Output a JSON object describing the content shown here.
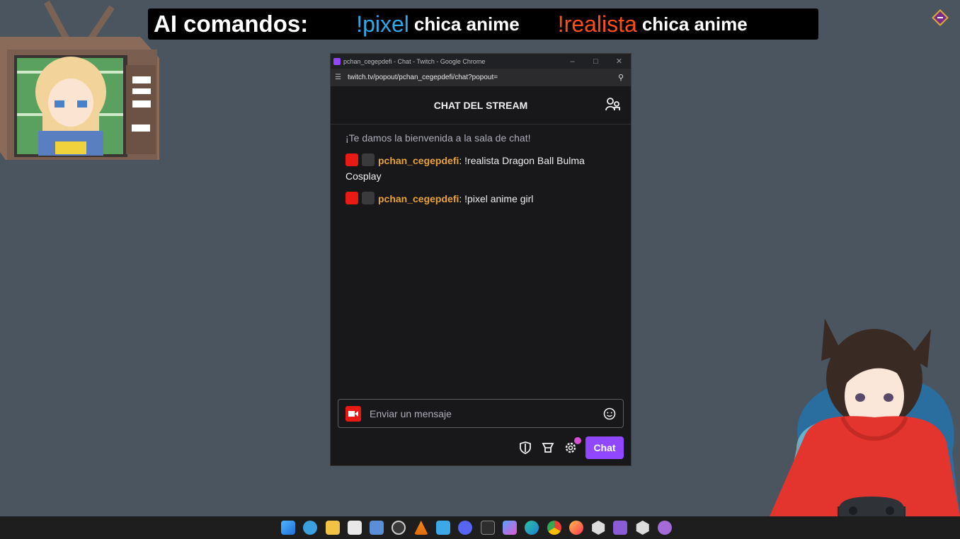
{
  "banner": {
    "lead": "AI comandos:",
    "cmd1": "!pixel",
    "rest1": "chica anime",
    "cmd2": "!realista",
    "rest2": "chica anime",
    "colors": {
      "pixel": "#2ea8e6",
      "realista": "#ff4d1a"
    }
  },
  "window": {
    "title": "pchan_cegepdefi - Chat - Twitch - Google Chrome",
    "url": "twitch.tv/popout/pchan_cegepdefi/chat?popout="
  },
  "chat": {
    "header": "CHAT DEL STREAM",
    "welcome": "¡Te damos la bienvenida a la sala de chat!",
    "messages": [
      {
        "user": "pchan_cegepdefi",
        "text": ": !realista Dragon Ball Bulma Cosplay"
      },
      {
        "user": "pchan_cegepdefi",
        "text": ": !pixel anime girl"
      }
    ],
    "input_placeholder": "Enviar un mensaje",
    "send_label": "Chat",
    "accent": "#9147ff",
    "username_color": "#e8a33d"
  },
  "taskbar": {
    "icons": [
      "windows-start-icon",
      "widgets-icon",
      "file-explorer-icon",
      "snipping-tool-icon",
      "vs-code-icon",
      "obs-icon",
      "vlc-icon",
      "notepad-icon",
      "discord-icon",
      "terminal-icon",
      "copilot-icon",
      "edge-icon",
      "chrome-icon",
      "firefox-icon",
      "unity-icon",
      "visual-studio-icon",
      "unity-hub-icon",
      "github-icon"
    ]
  }
}
